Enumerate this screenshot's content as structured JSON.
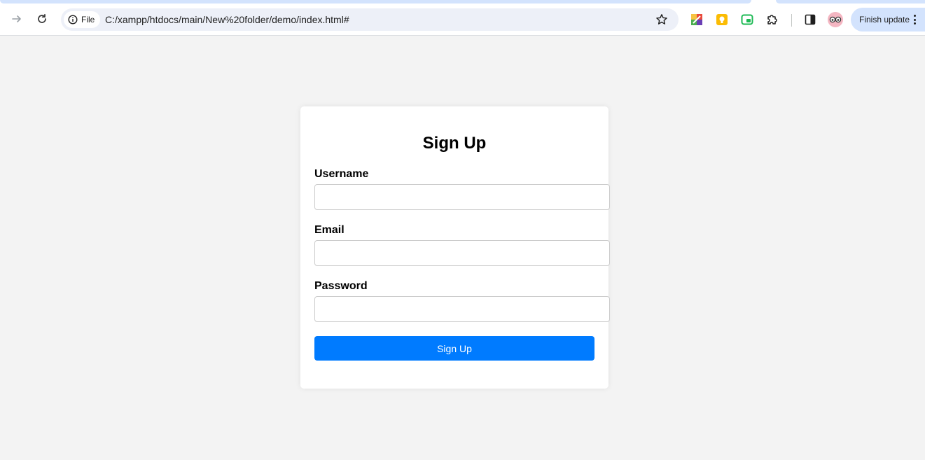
{
  "browser": {
    "security_chip_label": "File",
    "url": "C:/xampp/htdocs/main/New%20folder/demo/index.html#",
    "finish_update_label": "Finish update",
    "colors": {
      "tab_accent": "#d3e3fd",
      "omnibox_bg": "#edf0f8"
    }
  },
  "extensions": [
    {
      "icon": "color-picker-extension-icon"
    },
    {
      "icon": "lightbulb-extension-icon"
    },
    {
      "icon": "picture-in-picture-extension-icon"
    },
    {
      "icon": "puzzle-extensions-icon"
    },
    {
      "icon": "side-panel-icon"
    },
    {
      "icon": "profile-avatar-icon"
    }
  ],
  "form": {
    "title": "Sign Up",
    "fields": [
      {
        "label": "Username",
        "value": "",
        "placeholder": ""
      },
      {
        "label": "Email",
        "value": "",
        "placeholder": ""
      },
      {
        "label": "Password",
        "value": "",
        "placeholder": ""
      }
    ],
    "submit_label": "Sign Up",
    "colors": {
      "page_bg": "#f3f3f3",
      "card_bg": "#ffffff",
      "button_bg": "#007bff",
      "button_text": "#ffffff"
    }
  }
}
